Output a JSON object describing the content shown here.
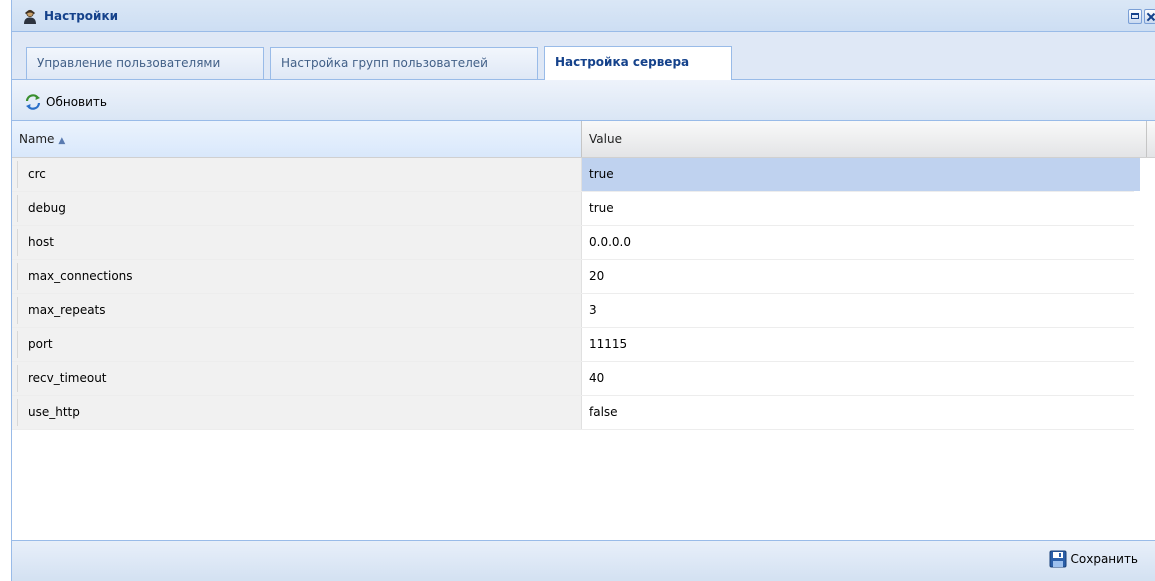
{
  "window": {
    "title": "Настройки",
    "icons": {
      "title": "user-icon",
      "maximize": "maximize-icon",
      "close": "close-icon"
    }
  },
  "tabs": [
    {
      "label": "Управление пользователями",
      "active": false
    },
    {
      "label": "Настройка групп пользователей",
      "active": false
    },
    {
      "label": "Настройка сервера",
      "active": true
    }
  ],
  "toolbar": {
    "refresh_label": "Обновить",
    "refresh_icon": "refresh-icon"
  },
  "grid": {
    "columns": {
      "name": "Name",
      "value": "Value"
    },
    "sort": {
      "column": "name",
      "direction": "asc"
    },
    "rows": [
      {
        "name": "crc",
        "value": "true",
        "selected": true
      },
      {
        "name": "debug",
        "value": "true"
      },
      {
        "name": "host",
        "value": "0.0.0.0"
      },
      {
        "name": "max_connections",
        "value": "20"
      },
      {
        "name": "max_repeats",
        "value": "3"
      },
      {
        "name": "port",
        "value": "11115"
      },
      {
        "name": "recv_timeout",
        "value": "40"
      },
      {
        "name": "use_http",
        "value": "false"
      }
    ]
  },
  "footer": {
    "save_label": "Сохранить",
    "save_icon": "floppy-disk-icon"
  },
  "colors": {
    "header_text": "#15428b",
    "border": "#99bbe8",
    "selected_row": "#bfd2ef"
  }
}
